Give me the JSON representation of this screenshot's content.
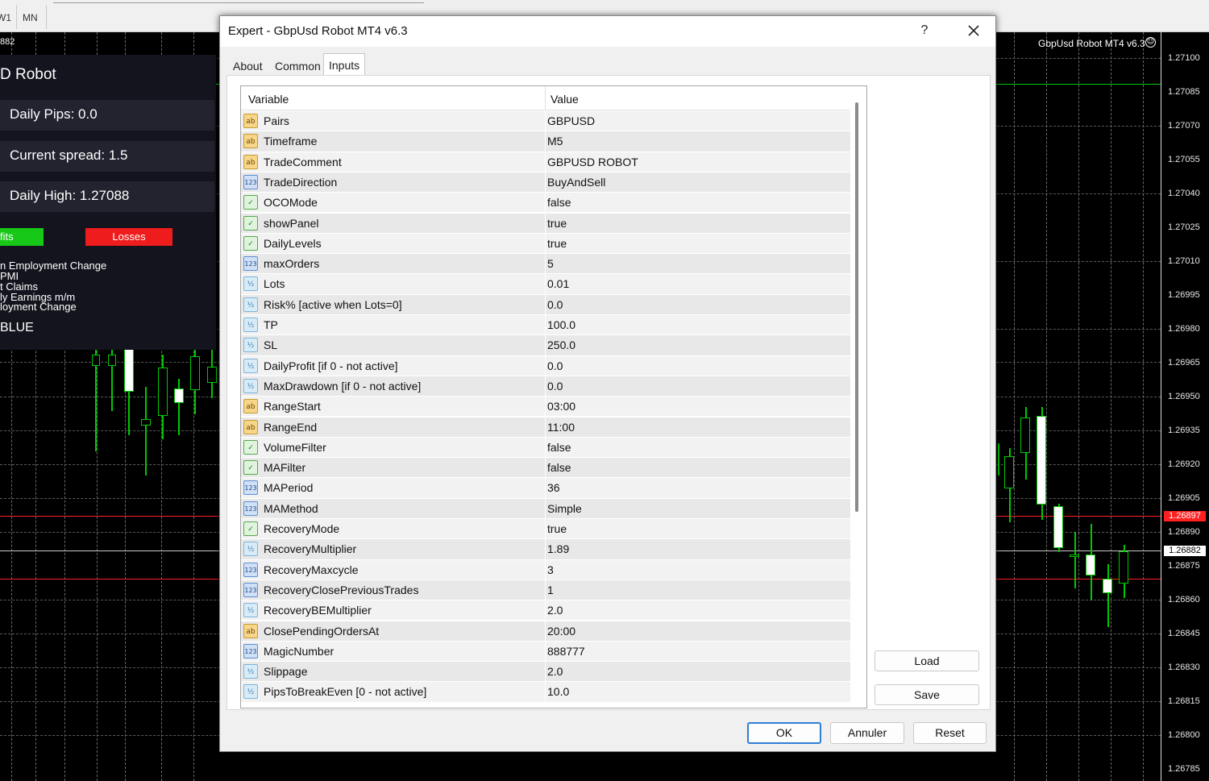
{
  "toolbar": {
    "timeframes": [
      "W1",
      "MN"
    ]
  },
  "chart": {
    "corner_price": "882",
    "title": "GbpUsd Robot MT4 v6.3",
    "prices": [
      "1.27100",
      "1.27085",
      "1.27070",
      "1.27055",
      "1.27040",
      "1.27025",
      "1.27010",
      "1.26995",
      "1.26980",
      "1.26965",
      "1.26950",
      "1.26935",
      "1.26920",
      "1.26905",
      "1.26890",
      "1.26875",
      "1.26860",
      "1.26845",
      "1.26830",
      "1.26815",
      "1.26800",
      "1.26785"
    ],
    "bid_tag": "1.26897",
    "ask_tag": "1.26882",
    "colors": {
      "bull": "#00c800",
      "sell_line": "#ff2020",
      "buy_line": "#ffffff",
      "level_line": "#00c800"
    }
  },
  "panel": {
    "title": "D Robot",
    "daily_pips": "Daily Pips:  0.0",
    "current_spread": "Current spread:  1.5",
    "daily_high": "Daily High:  1.27088",
    "profits_label": "fits",
    "losses_label": "Losses",
    "news": [
      "n Employment Change",
      "PMI",
      "t Claims",
      "ly Earnings m/m",
      "loyment Change"
    ],
    "footer": "BLUE"
  },
  "dialog": {
    "title": "Expert - GbpUsd Robot MT4 v6.3",
    "help": "?",
    "tabs": [
      "About",
      "Common",
      "Inputs"
    ],
    "active_tab": "Inputs",
    "columns": {
      "variable": "Variable",
      "value": "Value"
    },
    "rows": [
      {
        "icon": "ab",
        "name": "Pairs",
        "value": "GBPUSD"
      },
      {
        "icon": "ab",
        "name": "Timeframe",
        "value": "M5"
      },
      {
        "icon": "ab",
        "name": "TradeComment",
        "value": "GBPUSD ROBOT"
      },
      {
        "icon": "123",
        "name": "TradeDirection",
        "value": "BuyAndSell"
      },
      {
        "icon": "bool",
        "name": "OCOMode",
        "value": "false"
      },
      {
        "icon": "bool",
        "name": "showPanel",
        "value": "true"
      },
      {
        "icon": "bool",
        "name": "DailyLevels",
        "value": "true"
      },
      {
        "icon": "123",
        "name": "maxOrders",
        "value": "5"
      },
      {
        "icon": "v2",
        "name": "Lots",
        "value": "0.01"
      },
      {
        "icon": "v2",
        "name": "Risk% [active when Lots=0]",
        "value": "0.0"
      },
      {
        "icon": "v2",
        "name": "TP",
        "value": "100.0"
      },
      {
        "icon": "v2",
        "name": "SL",
        "value": "250.0"
      },
      {
        "icon": "v2",
        "name": "DailyProfit [if 0 - not active]",
        "value": "0.0"
      },
      {
        "icon": "v2",
        "name": "MaxDrawdown [if 0 - not active]",
        "value": "0.0"
      },
      {
        "icon": "ab",
        "name": "RangeStart",
        "value": "03:00"
      },
      {
        "icon": "ab",
        "name": "RangeEnd",
        "value": "11:00"
      },
      {
        "icon": "bool",
        "name": "VolumeFilter",
        "value": "false"
      },
      {
        "icon": "bool",
        "name": "MAFilter",
        "value": "false"
      },
      {
        "icon": "123",
        "name": "MAPeriod",
        "value": "36"
      },
      {
        "icon": "123",
        "name": "MAMethod",
        "value": "Simple"
      },
      {
        "icon": "bool",
        "name": "RecoveryMode",
        "value": "true"
      },
      {
        "icon": "v2",
        "name": "RecoveryMultiplier",
        "value": "1.89"
      },
      {
        "icon": "123",
        "name": "RecoveryMaxcycle",
        "value": "3"
      },
      {
        "icon": "123",
        "name": "RecoveryClosePreviousTrades",
        "value": "1"
      },
      {
        "icon": "v2",
        "name": "RecoveryBEMultiplier",
        "value": "2.0"
      },
      {
        "icon": "ab",
        "name": "ClosePendingOrdersAt",
        "value": "20:00"
      },
      {
        "icon": "123",
        "name": "MagicNumber",
        "value": "888777"
      },
      {
        "icon": "v2",
        "name": "Slippage",
        "value": "2.0"
      },
      {
        "icon": "v2",
        "name": "PipsToBreakEven [0 - not active]",
        "value": "10.0"
      }
    ],
    "buttons": {
      "load": "Load",
      "save": "Save",
      "ok": "OK",
      "cancel": "Annuler",
      "reset": "Reset"
    }
  }
}
